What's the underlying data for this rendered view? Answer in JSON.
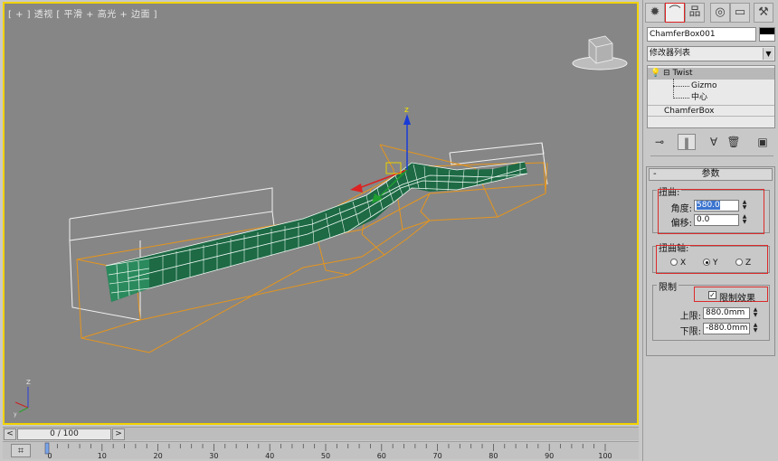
{
  "viewport": {
    "label": "[ + ] 透视 [ 平滑 + 高光 + 边面 ]",
    "axis_z_label": "Z",
    "axis_y_label": "y",
    "gizmo_label": "z"
  },
  "timeline": {
    "frame_label": "0 / 100",
    "prev_label": "<",
    "next_label": ">",
    "ticks": [
      "0",
      "10",
      "20",
      "30",
      "40",
      "50",
      "60",
      "70",
      "80",
      "90",
      "100"
    ]
  },
  "panel": {
    "tabs": [
      {
        "icon": "sun-icon",
        "glyph": "✹"
      },
      {
        "icon": "curve-modify-icon",
        "glyph": "⌒"
      },
      {
        "icon": "hierarchy-icon",
        "glyph": "品"
      },
      {
        "icon": "motion-icon",
        "glyph": "◎"
      },
      {
        "icon": "display-icon",
        "glyph": "▭"
      },
      {
        "icon": "hammer-icon",
        "glyph": "⚒"
      }
    ],
    "object_name": "ChamferBox001",
    "object_color": "#000000",
    "modifier_list": "修改器列表",
    "stack": {
      "twist": "Twist",
      "gizmo": "Gizmo",
      "center": "中心",
      "base": "ChamferBox"
    },
    "stack_tools": [
      {
        "icon": "pin-icon",
        "glyph": "⊸"
      },
      {
        "icon": "show-end-result-icon",
        "glyph": "‖"
      },
      {
        "icon": "make-unique-icon",
        "glyph": "∀"
      },
      {
        "icon": "remove-modifier-icon",
        "glyph": "🗑"
      },
      {
        "icon": "configure-sets-icon",
        "glyph": "▣"
      }
    ],
    "rollout": {
      "minus": "-",
      "title": "参数",
      "twist_group": "扭曲:",
      "angle_label": "角度:",
      "angle_value": "580.0",
      "bias_label": "偏移:",
      "bias_value": "0.0",
      "axis_group": "扭曲轴:",
      "axis_x": "X",
      "axis_y": "Y",
      "axis_z": "Z",
      "axis_selected": "Y",
      "limit_group": "限制",
      "limit_effect": "限制效果",
      "limit_checked": true,
      "upper_label": "上限:",
      "upper_value": "880.0mm",
      "lower_label": "下限:",
      "lower_value": "-880.0mm"
    }
  }
}
